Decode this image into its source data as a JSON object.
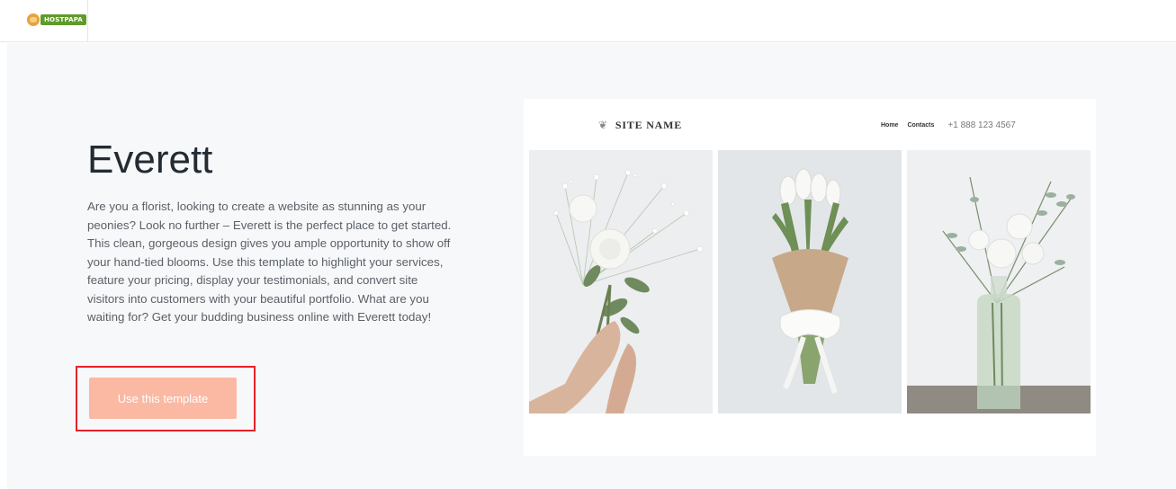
{
  "header": {
    "logo_text": "HOSTPAPA"
  },
  "template": {
    "title": "Everett",
    "description": "Are you a florist, looking to create a website as stunning as your peonies? Look no further – Everett is the perfect place to get started. This clean, gorgeous design gives you ample opportunity to show off your hand-tied blooms. Use this template to highlight your services, feature your pricing, display your testimonials, and convert site visitors into customers with your beautiful portfolio. What are you waiting for? Get your budding business online with Everett today!",
    "cta_label": "Use this template",
    "cta_color": "#fbb8a2",
    "highlight_color": "#e8202a"
  },
  "preview": {
    "site_name": "SITE NAME",
    "brand_icon": "flower-icon",
    "nav": [
      "Home",
      "Contacts"
    ],
    "phone": "+1 888 123 4567",
    "images": [
      "bouquet-in-hand-photo",
      "wrapped-tulips-photo",
      "flowers-in-vase-photo"
    ]
  }
}
